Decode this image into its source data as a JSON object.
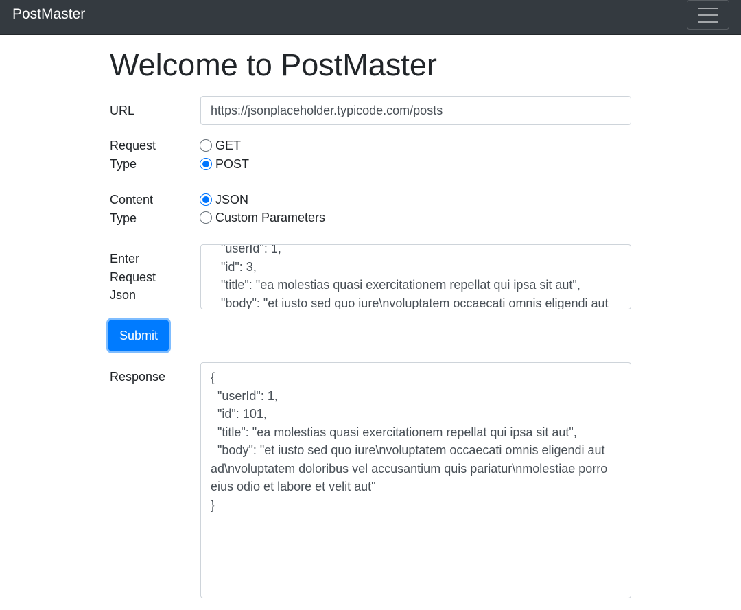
{
  "navbar": {
    "brand": "PostMaster",
    "toggler_icon": "hamburger-menu-icon"
  },
  "main": {
    "title": "Welcome to PostMaster",
    "url": {
      "label": "URL",
      "value": "https://jsonplaceholder.typicode.com/posts"
    },
    "request_type": {
      "label_line1": "Request",
      "label_line2": "Type",
      "options": [
        {
          "label": "GET",
          "checked": false
        },
        {
          "label": "POST",
          "checked": true
        }
      ]
    },
    "content_type": {
      "label_line1": "Content",
      "label_line2": "Type",
      "options": [
        {
          "label": "JSON",
          "checked": true
        },
        {
          "label": "Custom Parameters",
          "checked": false
        }
      ]
    },
    "request_json": {
      "label_line1": "Enter",
      "label_line2": "Request",
      "label_line3": "Json",
      "lines": [
        "\"userId\": 1,",
        "\"id\": 3,",
        "\"title\": \"ea molestias quasi exercitationem repellat qui ipsa sit aut\",",
        "\"body\": \"et iusto sed quo iure\\nvoluptatem occaecati omnis eligendi aut"
      ]
    },
    "submit_label": "Submit",
    "response": {
      "label": "Response",
      "text": "{\n  \"userId\": 1,\n  \"id\": 101,\n  \"title\": \"ea molestias quasi exercitationem repellat qui ipsa sit aut\",\n  \"body\": \"et iusto sed quo iure\\nvoluptatem occaecati omnis eligendi aut ad\\nvoluptatem doloribus vel accusantium quis pariatur\\nmolestiae porro eius odio et labore et velit aut\"\n}"
    }
  }
}
